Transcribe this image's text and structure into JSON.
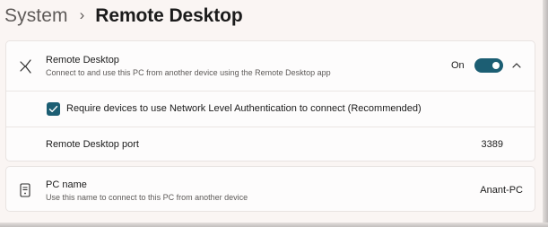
{
  "breadcrumb": {
    "parent": "System",
    "separator": "›",
    "current": "Remote Desktop"
  },
  "remote_desktop": {
    "icon": "remote-desktop-icon",
    "title": "Remote Desktop",
    "description": "Connect to and use this PC from another device using the Remote Desktop app",
    "toggle_state_label": "On",
    "toggle_on": true,
    "expanded": true
  },
  "nla": {
    "checked": true,
    "label": "Require devices to use Network Level Authentication to connect (Recommended)"
  },
  "port": {
    "label": "Remote Desktop port",
    "value": "3389"
  },
  "pc_name": {
    "icon": "pc-name-icon",
    "title": "PC name",
    "description": "Use this name to connect to this PC from another device",
    "value": "Anant-PC"
  },
  "colors": {
    "accent": "#1c5e73",
    "background": "#faf5f3",
    "card": "#fdfcfc"
  }
}
